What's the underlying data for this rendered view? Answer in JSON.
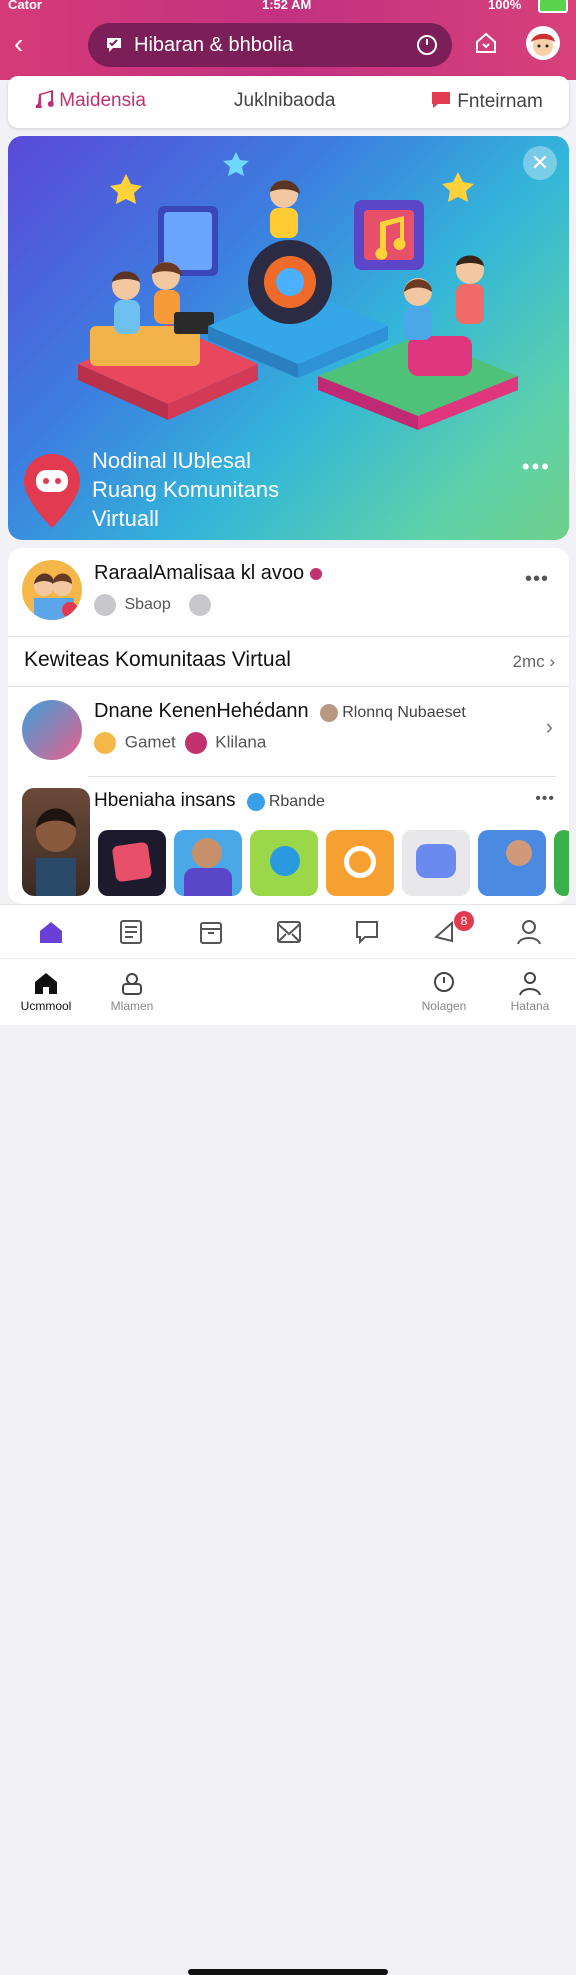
{
  "status_bar": {
    "carrier": "Cator",
    "time": "1:52 AM",
    "battery": "100%"
  },
  "header": {
    "search_text": "Hibaran & bhbolia"
  },
  "tabs": [
    {
      "label": "Maidensia"
    },
    {
      "label": "Juklnibaoda"
    },
    {
      "label": "Fnteirnam"
    }
  ],
  "hero": {
    "title_line1": "Nodinal lUblesal",
    "title_line2": "Ruang Komunitans",
    "title_line3": "Virtuall"
  },
  "feed": {
    "row1": {
      "title": "RaraalAmalisaa kl avoo",
      "chip1": "Sbaop"
    },
    "section": {
      "title": "Kewiteas Komunitaas Virtual",
      "more": "2mc"
    },
    "row2": {
      "title": "Dnane KenenHehédann",
      "badge": "Rlonnq Nubaeset",
      "chip1": "Gamet",
      "chip2": "Klilana"
    },
    "row3": {
      "title": "Hbeniaha insans",
      "badge": "Rbande"
    }
  },
  "bottom_nav": [
    {
      "label": "Ucmmool"
    },
    {
      "label": "Mlamen"
    },
    {
      "label": "Nolagen"
    },
    {
      "label": "Hatana"
    }
  ],
  "notification_count": "8",
  "colors": {
    "header_pink": "#d63a78",
    "accent_purple": "#6a3fd6",
    "badge_red": "#e23b4f"
  }
}
